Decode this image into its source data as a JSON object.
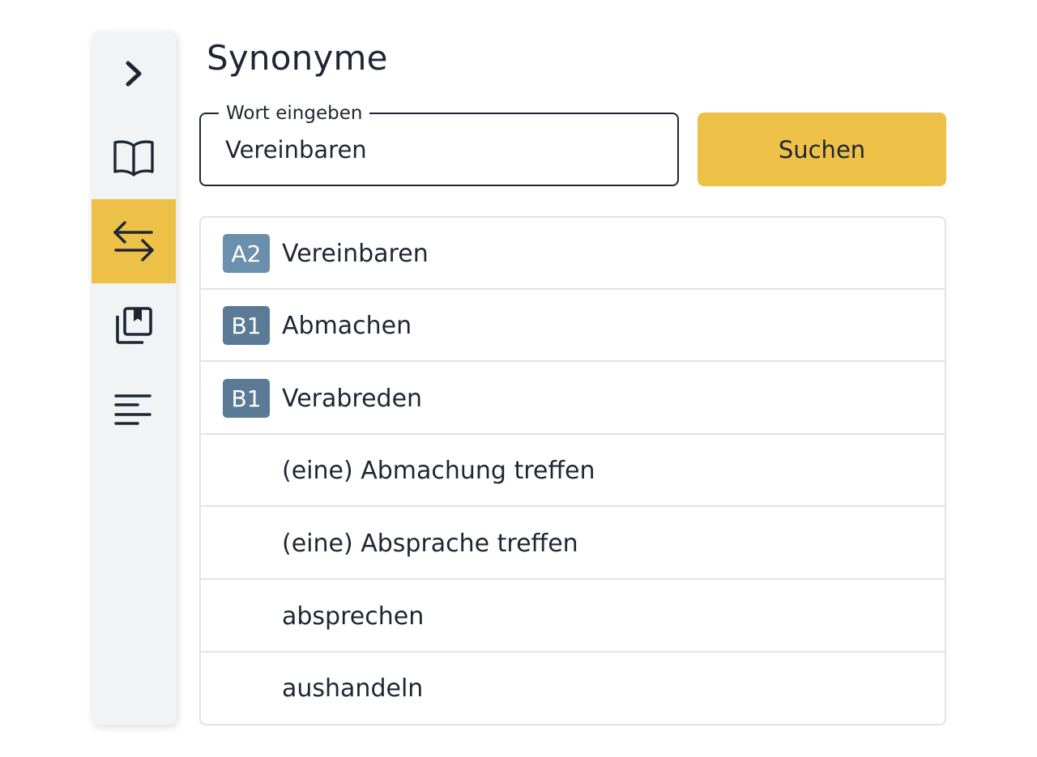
{
  "page": {
    "title": "Synonyme"
  },
  "sidebar": {
    "items": [
      {
        "icon": "chevron-right-icon",
        "active": false
      },
      {
        "icon": "open-book-icon",
        "active": false
      },
      {
        "icon": "swap-arrows-icon",
        "active": true
      },
      {
        "icon": "bookmark-library-icon",
        "active": false
      },
      {
        "icon": "text-lines-icon",
        "active": false
      }
    ],
    "active_color": "#edc148"
  },
  "search": {
    "label": "Wort eingeben",
    "value": "Vereinbaren",
    "button_label": "Suchen",
    "button_color": "#edc148"
  },
  "results": [
    {
      "level": "A2",
      "level_color": "#6b90ad",
      "word": "Vereinbaren"
    },
    {
      "level": "B1",
      "level_color": "#5a7a96",
      "word": "Abmachen"
    },
    {
      "level": "B1",
      "level_color": "#5a7a96",
      "word": "Verabreden"
    },
    {
      "level": "",
      "word": "(eine) Abmachung treffen"
    },
    {
      "level": "",
      "word": "(eine) Absprache treffen"
    },
    {
      "level": "",
      "word": "absprechen"
    },
    {
      "level": "",
      "word": "aushandeln"
    }
  ]
}
